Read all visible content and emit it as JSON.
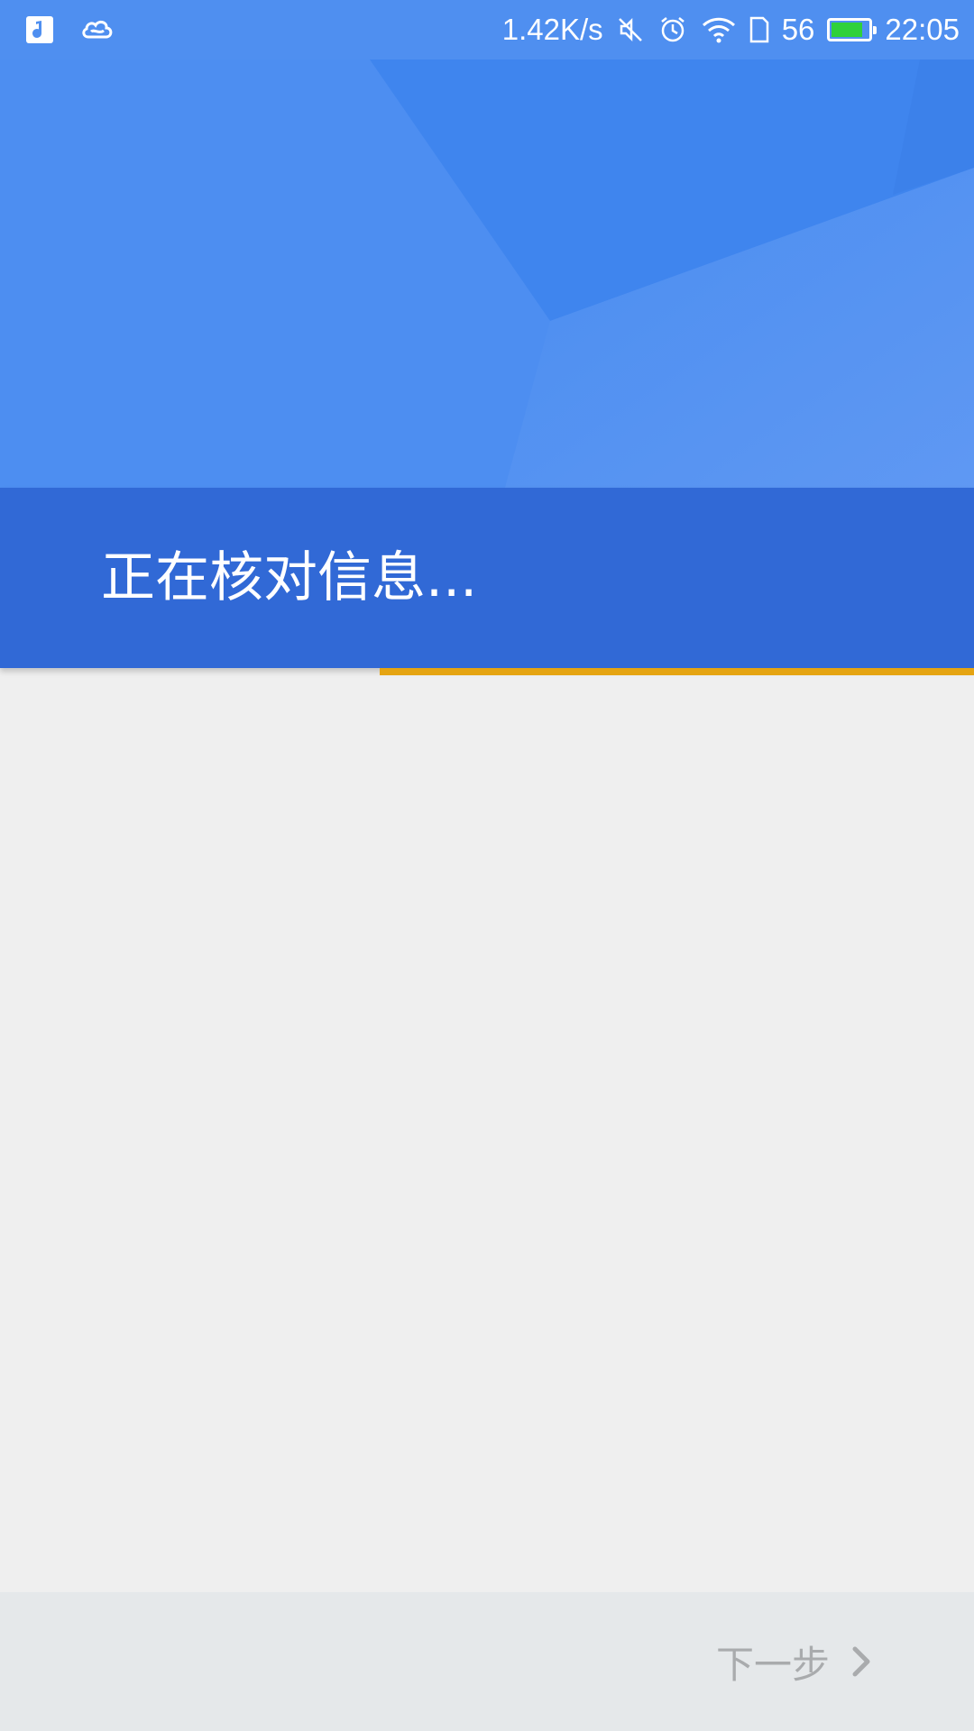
{
  "status_bar": {
    "left_icons": [
      "music-app-icon",
      "cloud-app-icon"
    ],
    "network_speed": "1.42K/s",
    "right_icons": [
      "mute-icon",
      "alarm-icon",
      "wifi-icon",
      "sim-icon"
    ],
    "signal_text": "56",
    "battery_level": 0.85,
    "time": "22:05"
  },
  "header": {
    "title": "正在核对信息...",
    "progress": 0.61,
    "colors": {
      "hero": "#4286ee",
      "band": "#3169d6",
      "progress": "#e5a412"
    }
  },
  "footer": {
    "next_label": "下一步",
    "next_icon": "chevron-right-icon"
  }
}
